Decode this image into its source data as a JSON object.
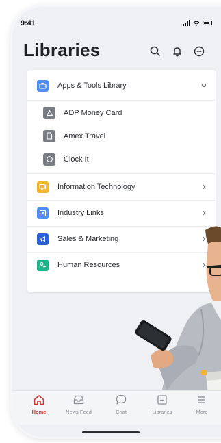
{
  "status_bar": {
    "time": "9:41"
  },
  "header": {
    "title": "Libraries"
  },
  "sections": [
    {
      "label": "Apps & Tools Library",
      "icon": "briefcase-icon",
      "color": "#4d8ef7",
      "expanded": true
    },
    {
      "label": "Information Technology",
      "icon": "monitor-icon",
      "color": "#f6b42c"
    },
    {
      "label": "Industry Links",
      "icon": "external-link-icon",
      "color": "#4d8ef7"
    },
    {
      "label": "Sales & Marketing",
      "icon": "megaphone-icon",
      "color": "#2b5fd9"
    },
    {
      "label": "Human Resources",
      "icon": "user-badge-icon",
      "color": "#1fb58a"
    }
  ],
  "apps": [
    {
      "label": "ADP Money Card",
      "icon": "triangle-icon"
    },
    {
      "label": "Amex Travel",
      "icon": "document-icon"
    },
    {
      "label": "Clock It",
      "icon": "circle-icon"
    }
  ],
  "tabs": [
    {
      "label": "Home",
      "icon": "home-icon",
      "active": true
    },
    {
      "label": "News Feed",
      "icon": "inbox-icon"
    },
    {
      "label": "Chat",
      "icon": "chat-bubble-icon"
    },
    {
      "label": "Libraries",
      "icon": "library-icon"
    },
    {
      "label": "More",
      "icon": "menu-icon"
    }
  ],
  "colors": {
    "accent": "#d6312e",
    "background": "#eef0f4"
  }
}
